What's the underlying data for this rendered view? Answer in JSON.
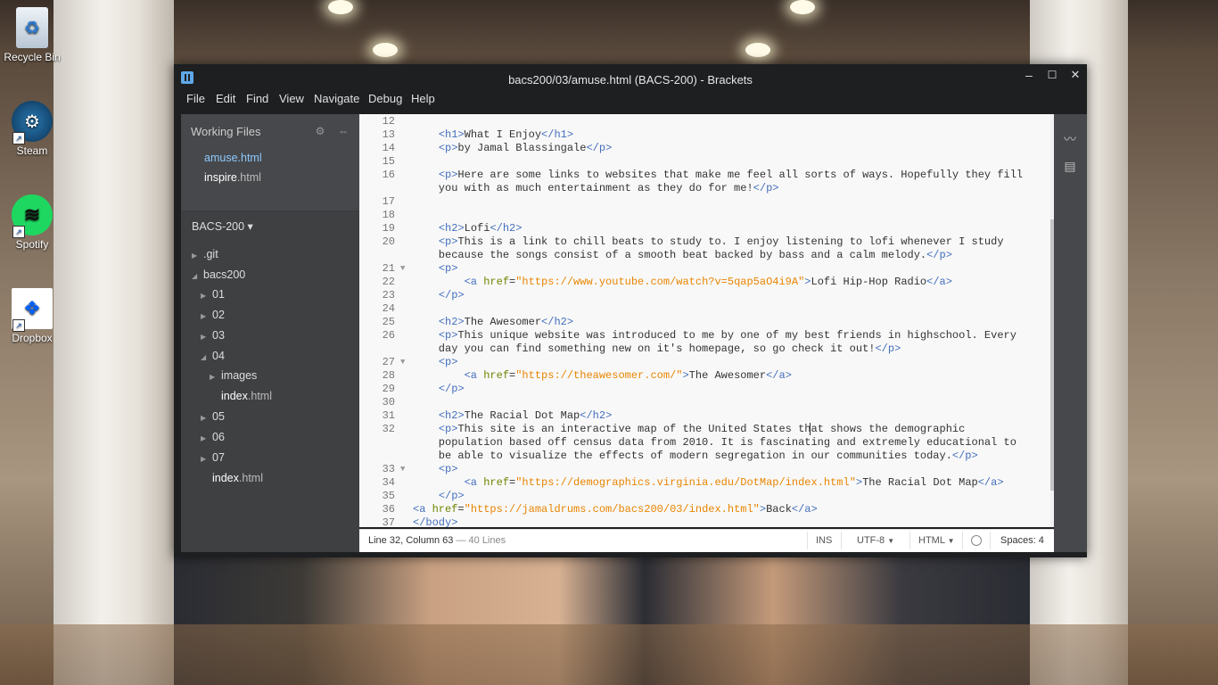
{
  "desktop": {
    "icons": [
      {
        "label": "Recycle Bin",
        "icon": "recycle-bin-icon"
      },
      {
        "label": "Steam",
        "icon": "steam-icon"
      },
      {
        "label": "Spotify",
        "icon": "spotify-icon"
      },
      {
        "label": "Dropbox",
        "icon": "dropbox-icon"
      }
    ]
  },
  "window": {
    "title": "bacs200/03/amuse.html (BACS-200) - Brackets",
    "minimize": "–",
    "maximize": "☐",
    "close": "✕"
  },
  "menu": [
    "File",
    "Edit",
    "Find",
    "View",
    "Navigate",
    "Debug",
    "Help"
  ],
  "sidebar": {
    "working_files_title": "Working Files",
    "working_files": [
      {
        "name": "amuse",
        "ext": ".html",
        "active": true
      },
      {
        "name": "inspire",
        "ext": ".html",
        "active": false
      }
    ],
    "project_name": "BACS-200 ▾",
    "tree": [
      {
        "label": ".git",
        "expanded": false
      },
      {
        "label": "bacs200",
        "expanded": true
      },
      {
        "label": "01",
        "expanded": false
      },
      {
        "label": "02",
        "expanded": false
      },
      {
        "label": "03",
        "expanded": false
      },
      {
        "label": "04",
        "expanded": true
      },
      {
        "label": "images",
        "expanded": false
      },
      {
        "label": "index",
        "ext": ".html"
      },
      {
        "label": "05",
        "expanded": false
      },
      {
        "label": "06",
        "expanded": false
      },
      {
        "label": "07",
        "expanded": false
      },
      {
        "label": "index",
        "ext": ".html"
      }
    ]
  },
  "editor": {
    "line_numbers": [
      "12",
      "13",
      "14",
      "15",
      "16",
      "",
      "17",
      "18",
      "19",
      "20",
      "",
      "21",
      "22",
      "23",
      "24",
      "25",
      "26",
      "",
      "27",
      "28",
      "29",
      "30",
      "31",
      "32",
      "",
      "",
      "33",
      "34",
      "35",
      "36",
      "37"
    ],
    "lines": [
      "",
      "    <h1>What I Enjoy</h1>",
      "    <p>by Jamal Blassingale</p>",
      "",
      "    <p>Here are some links to websites that make me feel all sorts of ways. Hopefully they fill",
      "    you with as much entertainment as they do for me!</p>",
      "",
      "",
      "    <h2>Lofi</h2>",
      "    <p>This is a link to chill beats to study to. I enjoy listening to lofi whenever I study",
      "    because the songs consist of a smooth beat backed by bass and a calm melody.</p>",
      "    <p>",
      "        <a href=\"https://www.youtube.com/watch?v=5qap5aO4i9A\">Lofi Hip-Hop Radio</a>",
      "    </p>",
      "",
      "    <h2>The Awesomer</h2>",
      "    <p>This unique website was introduced to me by one of my best friends in highschool. Every",
      "    day you can find something new on it's homepage, so go check it out!</p>",
      "    <p>",
      "        <a href=\"https://theawesomer.com/\">The Awesomer</a>",
      "    </p>",
      "",
      "    <h2>The Racial Dot Map</h2>",
      "    <p>This site is an interactive map of the United States that shows the demographic",
      "    population based off census data from 2010. It is fascinating and extremely educational to",
      "    be able to visualize the effects of modern segregation in our communities today.</p>",
      "    <p>",
      "        <a href=\"https://demographics.virginia.edu/DotMap/index.html\">The Racial Dot Map</a>",
      "    </p>",
      "<a href=\"https://jamaldrums.com/bacs200/03/index.html\">Back</a>",
      "</body>"
    ]
  },
  "status": {
    "position": "Line 32, Column 63",
    "line_count": "— 40 Lines",
    "mode": "INS",
    "encoding": "UTF-8",
    "language": "HTML",
    "spaces": "Spaces: 4"
  }
}
